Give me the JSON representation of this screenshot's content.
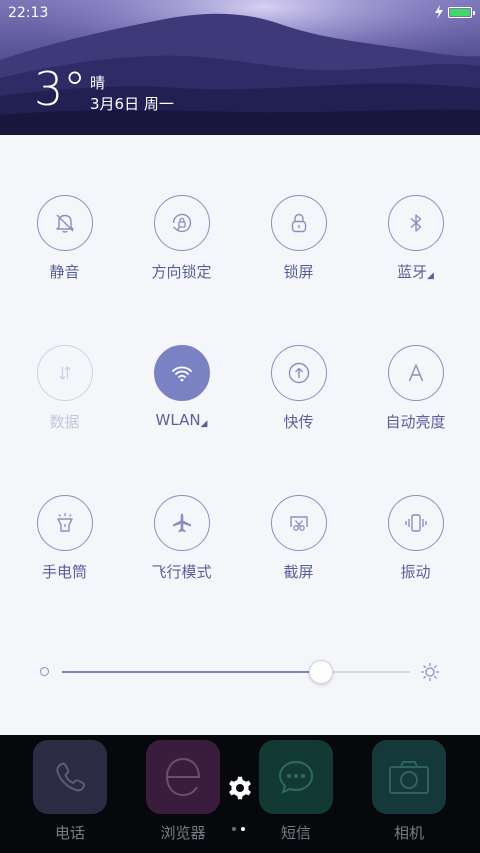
{
  "status_bar": {
    "time": "22:13",
    "battery_color": "#44d86a"
  },
  "weather": {
    "temperature": "3°",
    "condition": "晴",
    "date": "3月6日 周一"
  },
  "toggles": [
    {
      "name": "mute",
      "label": "静音",
      "icon": "bell-off-icon",
      "state": "off"
    },
    {
      "name": "rotation-lock",
      "label": "方向锁定",
      "icon": "rotation-lock-icon",
      "state": "off"
    },
    {
      "name": "lock-screen",
      "label": "锁屏",
      "icon": "lock-icon",
      "state": "off"
    },
    {
      "name": "bluetooth",
      "label": "蓝牙",
      "icon": "bluetooth-icon",
      "state": "off",
      "has_menu": true
    },
    {
      "name": "mobile-data",
      "label": "数据",
      "icon": "data-arrows-icon",
      "state": "disabled"
    },
    {
      "name": "wlan",
      "label": "WLAN",
      "icon": "wifi-icon",
      "state": "on",
      "has_menu": true
    },
    {
      "name": "quick-transfer",
      "label": "快传",
      "icon": "upload-icon",
      "state": "off"
    },
    {
      "name": "auto-brightness",
      "label": "自动亮度",
      "icon": "letter-a-icon",
      "state": "off"
    },
    {
      "name": "flashlight",
      "label": "手电筒",
      "icon": "flashlight-icon",
      "state": "off"
    },
    {
      "name": "airplane-mode",
      "label": "飞行模式",
      "icon": "airplane-icon",
      "state": "off"
    },
    {
      "name": "screenshot",
      "label": "截屏",
      "icon": "screenshot-icon",
      "state": "off"
    },
    {
      "name": "vibrate",
      "label": "振动",
      "icon": "vibrate-icon",
      "state": "off"
    }
  ],
  "brightness": {
    "level": 0.74
  },
  "dock": [
    {
      "label": "电话",
      "icon": "phone-icon",
      "color": "#2b2c44"
    },
    {
      "label": "浏览器",
      "icon": "browser-icon",
      "color": "#3a1d3d"
    },
    {
      "label": "短信",
      "icon": "message-icon",
      "color": "#123a33"
    },
    {
      "label": "相机",
      "icon": "camera-icon",
      "color": "#15383a"
    }
  ],
  "page_indicator": {
    "pages": 2,
    "active": 1
  },
  "colors": {
    "accent": "#7b82c4",
    "icon_stroke": "#8a8fc0",
    "panel_bg": "#f5f6fa"
  }
}
